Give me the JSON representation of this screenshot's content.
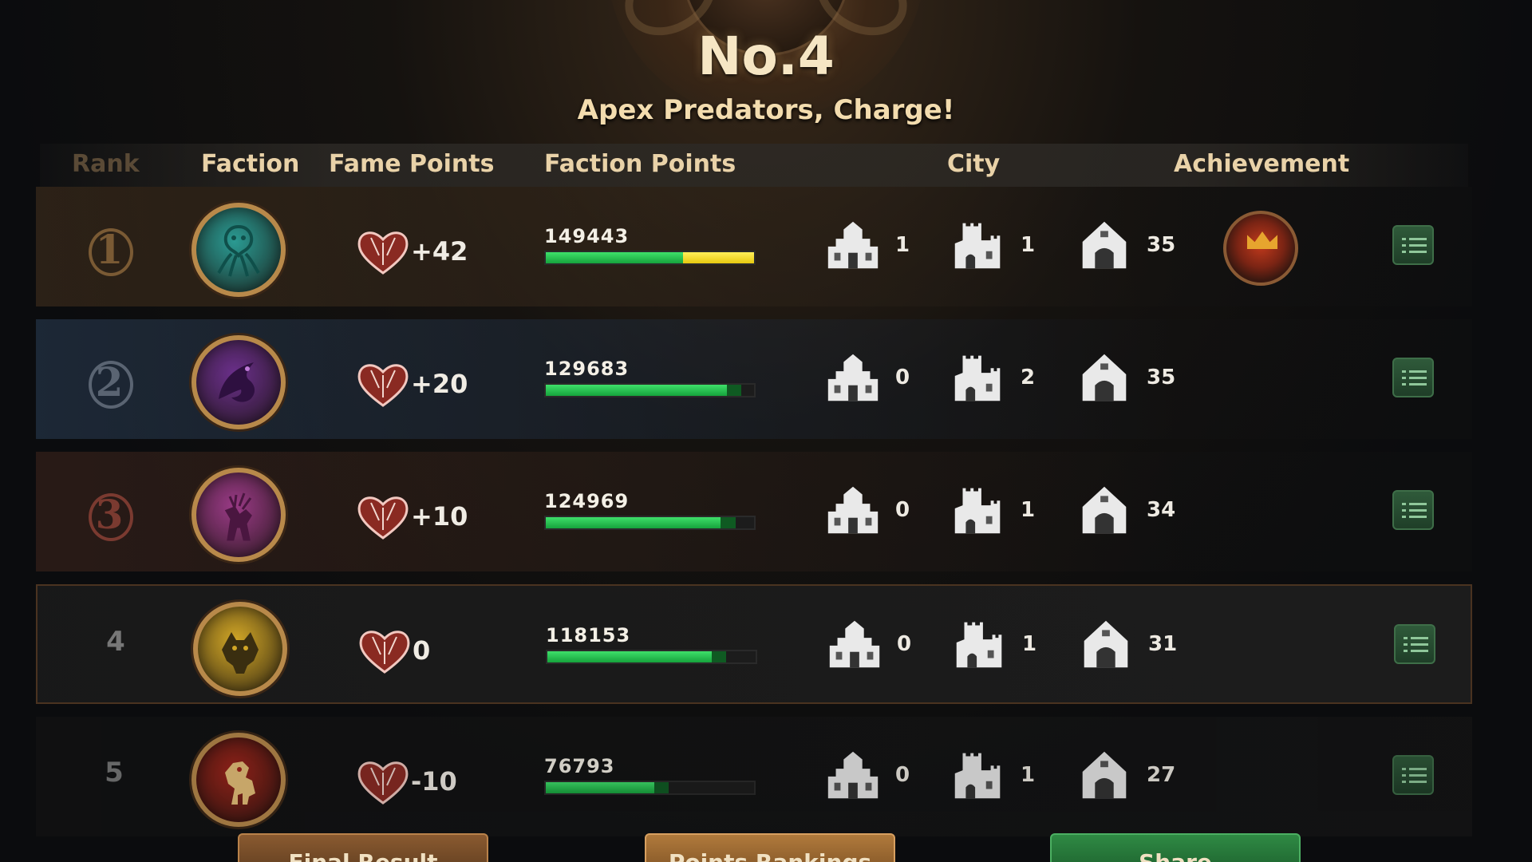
{
  "header": {
    "rank_title": "No.4",
    "subtitle": "Apex Predators, Charge!"
  },
  "columns": {
    "rank": "Rank",
    "faction": "Faction",
    "fame_points": "Fame Points",
    "faction_points": "Faction Points",
    "city": "City",
    "achievement": "Achievement"
  },
  "rows": [
    {
      "rank": "1",
      "faction_icon": "kraken-sigil-icon",
      "faction_color": "#2a9a92",
      "fame": "+42",
      "faction_points": "149443",
      "bar_fraction": 0.66,
      "bar_extra_fraction": 0.34,
      "city_counts": [
        "1",
        "1",
        "35"
      ],
      "has_achievement": true
    },
    {
      "rank": "2",
      "faction_icon": "dragon-sigil-icon",
      "faction_color": "#6a2f8a",
      "fame": "+20",
      "faction_points": "129683",
      "bar_fraction": 0.87,
      "has_achievement": false,
      "city_counts": [
        "0",
        "2",
        "35"
      ]
    },
    {
      "rank": "3",
      "faction_icon": "stag-sigil-icon",
      "faction_color": "#9a3a86",
      "fame": "+10",
      "faction_points": "124969",
      "bar_fraction": 0.84,
      "has_achievement": false,
      "city_counts": [
        "0",
        "1",
        "34"
      ]
    },
    {
      "rank": "4",
      "faction_icon": "direwolf-sigil-icon",
      "faction_color": "#d1a626",
      "fame": "0",
      "faction_points": "118153",
      "bar_fraction": 0.79,
      "has_achievement": false,
      "city_counts": [
        "0",
        "1",
        "31"
      ]
    },
    {
      "rank": "5",
      "faction_icon": "lion-sigil-icon",
      "faction_color": "#a3241a",
      "fame": "-10",
      "faction_points": "76793",
      "bar_fraction": 0.52,
      "has_achievement": false,
      "city_counts": [
        "0",
        "1",
        "27"
      ]
    }
  ],
  "icons": {
    "fame": "fame-heart-icon",
    "city_types": [
      "palace-icon",
      "fortress-icon",
      "castle-icon"
    ],
    "achievement": "achievement-crown-medal-icon",
    "details": "list-details-icon"
  },
  "bottom_buttons": [
    "Final Result",
    "Points Rankings",
    "Share"
  ]
}
